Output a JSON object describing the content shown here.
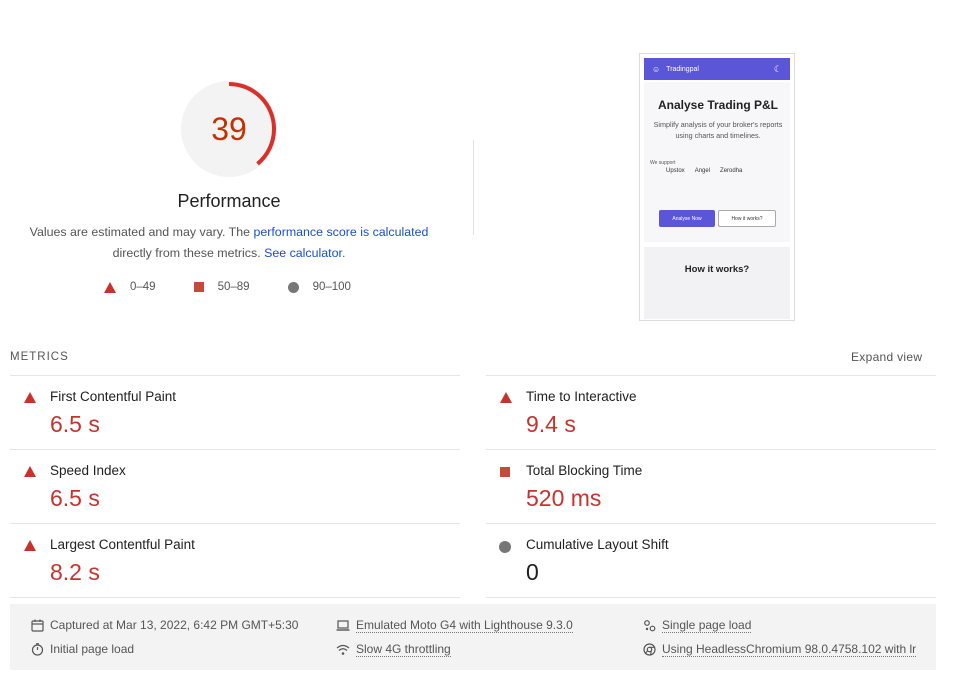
{
  "score": {
    "value": "39",
    "fraction": 0.39,
    "color": "#c33300",
    "title": "Performance",
    "desc_prefix": "Values are estimated and may vary. The ",
    "desc_link1": "performance score is calculated",
    "desc_middle": " directly from these metrics. ",
    "desc_link2": "See calculator",
    "desc_suffix": "."
  },
  "legend": [
    {
      "shape": "triangle",
      "label": "0–49"
    },
    {
      "shape": "square",
      "label": "50–89"
    },
    {
      "shape": "circle",
      "label": "90–100"
    }
  ],
  "thumbnail": {
    "brand": "Tradingpal",
    "title": "Analyse Trading P&L",
    "subtitle": "Simplify analysis of your broker's reports using charts and timelines.",
    "support_label": "We support",
    "brokers": [
      "Upstox",
      "Angel",
      "Zerodha"
    ],
    "primary_button": "Analyse Now",
    "secondary_button": "How it works?",
    "section_title": "How it works?"
  },
  "metrics": {
    "title": "METRICS",
    "expand_label": "Expand view",
    "items": [
      {
        "label": "First Contentful Paint",
        "value": "6.5 s",
        "status": "fail"
      },
      {
        "label": "Time to Interactive",
        "value": "9.4 s",
        "status": "fail"
      },
      {
        "label": "Speed Index",
        "value": "6.5 s",
        "status": "fail"
      },
      {
        "label": "Total Blocking Time",
        "value": "520 ms",
        "status": "average"
      },
      {
        "label": "Largest Contentful Paint",
        "value": "8.2 s",
        "status": "fail"
      },
      {
        "label": "Cumulative Layout Shift",
        "value": "0",
        "status": "pass"
      }
    ]
  },
  "footer": {
    "captured": "Captured at Mar 13, 2022, 6:42 PM GMT+5:30",
    "initial": "Initial page load",
    "device": "Emulated Moto G4 with Lighthouse 9.3.0",
    "throttling": "Slow 4G throttling",
    "single": "Single page load",
    "browser": "Using HeadlessChromium 98.0.4758.102 with lr"
  },
  "colors": {
    "fail": "#c8322d",
    "average": "#c44a3b",
    "pass": "#777777",
    "accent": "#5b55d8",
    "link": "#1a4fcf"
  }
}
